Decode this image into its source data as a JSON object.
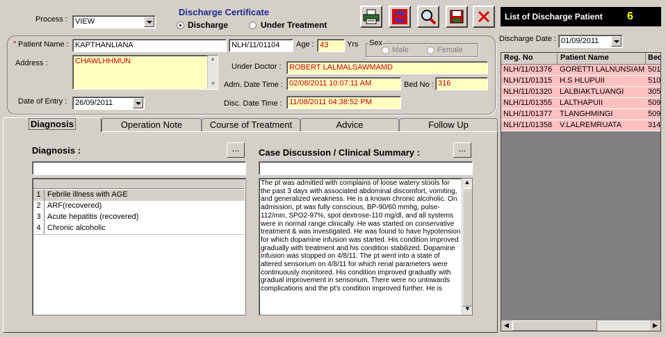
{
  "header": {
    "title": "Discharge Certificate",
    "process_label": "Process :",
    "process_value": "VIEW",
    "radio_discharge": "Discharge",
    "radio_under_treatment": "Under Treatment"
  },
  "patient": {
    "name_label": "Patient Name :",
    "name": "KAPTHANLIANA",
    "reg_no": "NLH/11/01104",
    "age_label": "Age :",
    "age": "43",
    "yrs_label": "Yrs",
    "sex_label": "Sex",
    "sex_male": "Male",
    "sex_female": "Female",
    "address_label": "Address :",
    "address": "CHAWLHHMUN",
    "under_doctor_label": "Under Doctor :",
    "under_doctor": "ROBERT LALMALSAWMAMD",
    "adm_label": "Adm. Date Time :",
    "adm_datetime": "02/08/2011 10:07:11 AM",
    "bed_label": "Bed No :",
    "bed_no": "316",
    "entry_label": "Date of Entry :",
    "entry_date": "26/09/2011",
    "disc_label": "Disc. Date Time :",
    "disc_datetime": "11/08/2011 04:38:52 PM"
  },
  "tabs": [
    "Diagnosis",
    "Operation Note",
    "Course of Treatment",
    "Advice",
    "Follow Up"
  ],
  "diagnosis": {
    "label": "Diagnosis :",
    "dots": "...",
    "items": [
      {
        "num": "1",
        "text": "Febrile illness with AGE"
      },
      {
        "num": "2",
        "text": "ARF(recovered)"
      },
      {
        "num": "3",
        "text": "Acute hepatitis (recovered)"
      },
      {
        "num": "4",
        "text": "Chronic alcoholic"
      }
    ]
  },
  "case": {
    "label": "Case Discussion / Clinical Summary :",
    "dots": "...",
    "text": "The pt was admitted with complains of loose watery stools for the past 3 days with associated abdominal discomfort, vomiting, and generalized weakness. He is a known chronic alcoholic. On admission, pt was fully conscious, BP-90/60 mmhg, pulse-112/min, SPO2-97%, spot dextrose-110 mg/dl, and all systems were in normal range clinically. He was started on conservative treatment & was investigated. He was found to have hypotension for which dopamine infusion was started. His condition improved gradually with treatment and his condition stabilized. Dopamine infusion was stopped on 4/8/11. The pt went into a state of altered sensorium on 4/8/11 for which renal parameters were continuously monitored. His condition improved gradually with gradual improvement in sensorium. There were no untowards complications and the pt's condition improved further. He is"
  },
  "side": {
    "title": "List of Discharge Patient",
    "count": "6",
    "date_label": "Discharge Date :",
    "date": "01/09/2011",
    "col_reg": "Reg. No",
    "col_name": "Patient Name",
    "col_bed": "Bed",
    "rows": [
      {
        "reg": "NLH/11/01376",
        "name": "GORETTI LALNUNSIAMI",
        "bed": "501"
      },
      {
        "reg": "NLH/11/01315",
        "name": "H.S HLUPUII",
        "bed": "510"
      },
      {
        "reg": "NLH/11/01320",
        "name": "LALBIAKTLUANGI",
        "bed": "305"
      },
      {
        "reg": "NLH/11/01355",
        "name": "LALTHAPUII",
        "bed": "509"
      },
      {
        "reg": "NLH/11/01377",
        "name": "TLANGHMINGI",
        "bed": "509"
      },
      {
        "reg": "NLH/11/01358",
        "name": "V.LALREMRUATA",
        "bed": "314"
      }
    ]
  },
  "colors": {
    "title_blue": "#1f2a8c",
    "side_header_bg": "#000000",
    "count_yellow": "#ffff00",
    "yellow_field": "#ffffc0",
    "pink_row": "#ffc0c0"
  }
}
